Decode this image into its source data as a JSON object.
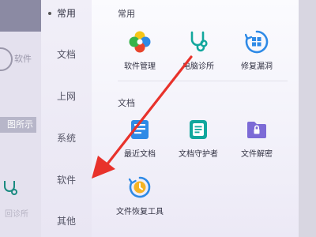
{
  "background_app": {
    "faded_text": "软件",
    "chip_text": "图所示",
    "icon_sub": "回诊所"
  },
  "sidebar": {
    "items": [
      {
        "label": "常用"
      },
      {
        "label": "文档"
      },
      {
        "label": "上网"
      },
      {
        "label": "系统"
      },
      {
        "label": "软件"
      },
      {
        "label": "其他"
      }
    ]
  },
  "sections": {
    "common": {
      "title": "常用",
      "tiles": [
        {
          "label": "软件管理",
          "icon": "clover-icon"
        },
        {
          "label": "电脑诊所",
          "icon": "stethoscope-icon"
        },
        {
          "label": "修复漏洞",
          "icon": "windows-repair-icon"
        }
      ]
    },
    "docs": {
      "title": "文档",
      "tiles": [
        {
          "label": "最近文档",
          "icon": "recent-docs-icon"
        },
        {
          "label": "文档守护者",
          "icon": "doc-guard-icon"
        },
        {
          "label": "文件解密",
          "icon": "folder-lock-icon"
        },
        {
          "label": "文件恢复工具",
          "icon": "file-recovery-icon"
        }
      ]
    }
  },
  "colors": {
    "annotation_arrow": "#e8322b",
    "accent_green": "#12a79d",
    "accent_blue": "#2e8ae6",
    "accent_purple": "#7c6ad6"
  }
}
